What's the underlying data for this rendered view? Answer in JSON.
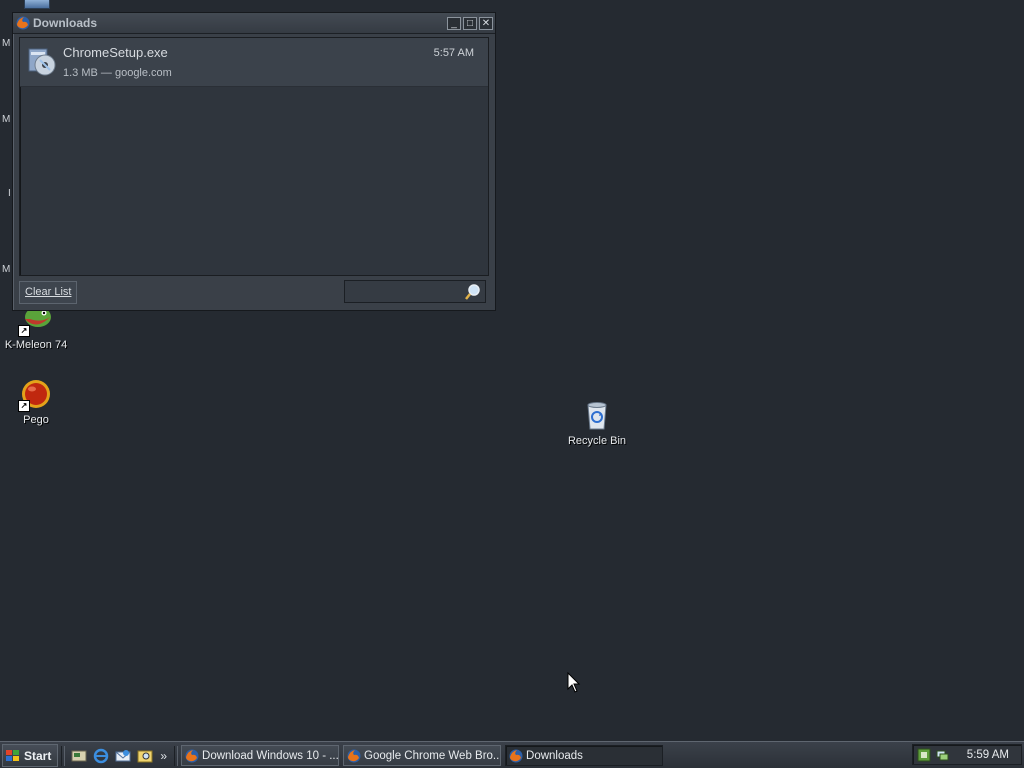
{
  "desktop": {
    "icons": [
      {
        "label": "K-Meleon 74"
      },
      {
        "label": "Pego"
      },
      {
        "label": "Recycle Bin"
      }
    ],
    "edge_chars": [
      "M",
      "M",
      "I",
      "M"
    ]
  },
  "downloads_window": {
    "title": "Downloads",
    "items": [
      {
        "name": "ChromeSetup.exe",
        "meta": "1.3 MB — google.com",
        "time": "5:57 AM"
      }
    ],
    "clear_label": "Clear List",
    "search": {
      "value": "",
      "placeholder": ""
    }
  },
  "taskbar": {
    "start_label": "Start",
    "overflow_label": "»",
    "tasks": [
      {
        "label": "Download Windows 10 - ...",
        "icon": "firefox-icon"
      },
      {
        "label": "Google Chrome Web Bro...",
        "icon": "firefox-icon"
      },
      {
        "label": "Downloads",
        "icon": "firefox-icon"
      }
    ],
    "clock": "5:59 AM"
  }
}
